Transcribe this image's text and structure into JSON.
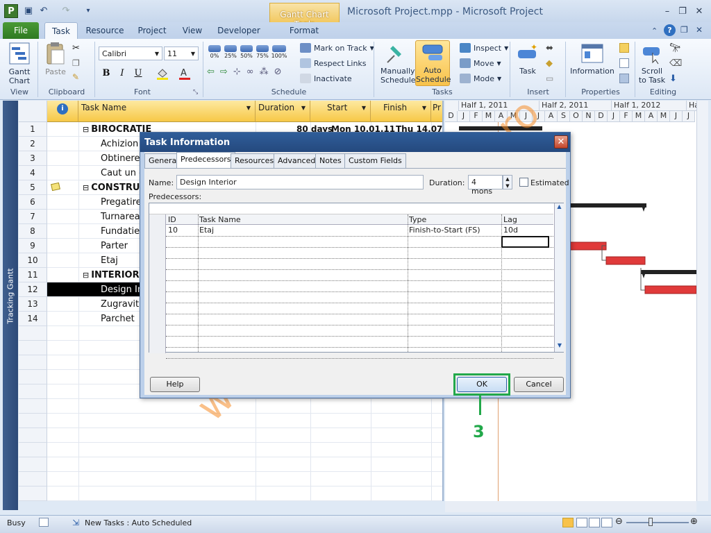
{
  "window": {
    "title": "Microsoft Project.mpp  -  Microsoft Project",
    "context_tab_group": "Gantt Chart Tools"
  },
  "ribbon_tabs": [
    "File",
    "Task",
    "Resource",
    "Project",
    "View",
    "Developer",
    "Format"
  ],
  "ribbon": {
    "view": {
      "gantt_chart": "Gantt\nChart",
      "label": "View"
    },
    "clipboard": {
      "paste": "Paste",
      "label": "Clipboard"
    },
    "font": {
      "family": "Calibri",
      "size": "11",
      "label": "Font",
      "bold": "B",
      "italic": "I",
      "underline": "U"
    },
    "schedule": {
      "pct": [
        "0%",
        "25%",
        "50%",
        "75%",
        "100%"
      ],
      "mark_on_track": "Mark on Track",
      "respect_links": "Respect Links",
      "inactivate": "Inactivate",
      "label": "Schedule"
    },
    "tasks": {
      "manually": "Manually\nSchedule",
      "auto": "Auto\nSchedule",
      "inspect": "Inspect",
      "move": "Move",
      "mode": "Mode",
      "label": "Tasks"
    },
    "insert": {
      "task": "Task",
      "label": "Insert"
    },
    "properties": {
      "information": "Information",
      "label": "Properties"
    },
    "editing": {
      "scroll": "Scroll\nto Task",
      "label": "Editing"
    }
  },
  "view_bar_label": "Tracking Gantt",
  "grid": {
    "columns": [
      "Task Name",
      "Duration",
      "Start",
      "Finish",
      "Pr"
    ],
    "rows": [
      {
        "id": "1",
        "name": "BIROCRATIE",
        "summary": true,
        "duration": "80 days",
        "start": "Mon 10.01.11",
        "finish": "Thu 14.07.11"
      },
      {
        "id": "2",
        "name": "Achizion",
        "summary": false
      },
      {
        "id": "3",
        "name": "Obtinere",
        "summary": false
      },
      {
        "id": "4",
        "name": "Caut un c",
        "summary": false
      },
      {
        "id": "5",
        "name": "CONSTRUCT",
        "summary": true,
        "note": true
      },
      {
        "id": "6",
        "name": "Pregatire",
        "summary": false
      },
      {
        "id": "7",
        "name": "Turnarea",
        "summary": false
      },
      {
        "id": "8",
        "name": "Fundatie",
        "summary": false
      },
      {
        "id": "9",
        "name": "Parter",
        "summary": false
      },
      {
        "id": "10",
        "name": "Etaj",
        "summary": false
      },
      {
        "id": "11",
        "name": "INTERIOR",
        "summary": true
      },
      {
        "id": "12",
        "name": "Design In",
        "summary": false,
        "selected": true
      },
      {
        "id": "13",
        "name": "Zugravit",
        "summary": false
      },
      {
        "id": "14",
        "name": "Parchet",
        "summary": false
      }
    ]
  },
  "gantt": {
    "halves": [
      "Half 1, 2011",
      "Half 2, 2011",
      "Half 1, 2012",
      "Ha"
    ],
    "months": [
      "D",
      "J",
      "F",
      "M",
      "A",
      "M",
      "J",
      "J",
      "A",
      "S",
      "O",
      "N",
      "D",
      "J",
      "F",
      "M",
      "A",
      "M",
      "J",
      "J"
    ]
  },
  "dialog": {
    "title": "Task Information",
    "tabs": [
      "General",
      "Predecessors",
      "Resources",
      "Advanced",
      "Notes",
      "Custom Fields"
    ],
    "name_label": "Name:",
    "name_value": "Design Interior",
    "duration_label": "Duration:",
    "duration_value": "4 mons",
    "estimated_label": "Estimated",
    "predecessors_label": "Predecessors:",
    "table_headers": [
      "ID",
      "Task Name",
      "Type",
      "Lag"
    ],
    "table_rows": [
      {
        "id": "10",
        "task": "Etaj",
        "type": "Finish-to-Start (FS)",
        "lag": "10d"
      }
    ],
    "help": "Help",
    "ok": "OK",
    "cancel": "Cancel"
  },
  "annotation": {
    "step": "3",
    "color": "#22a84a"
  },
  "watermark": "www.office-learning.ro",
  "statusbar": {
    "state": "Busy",
    "new_tasks": "New Tasks : Auto Scheduled"
  }
}
